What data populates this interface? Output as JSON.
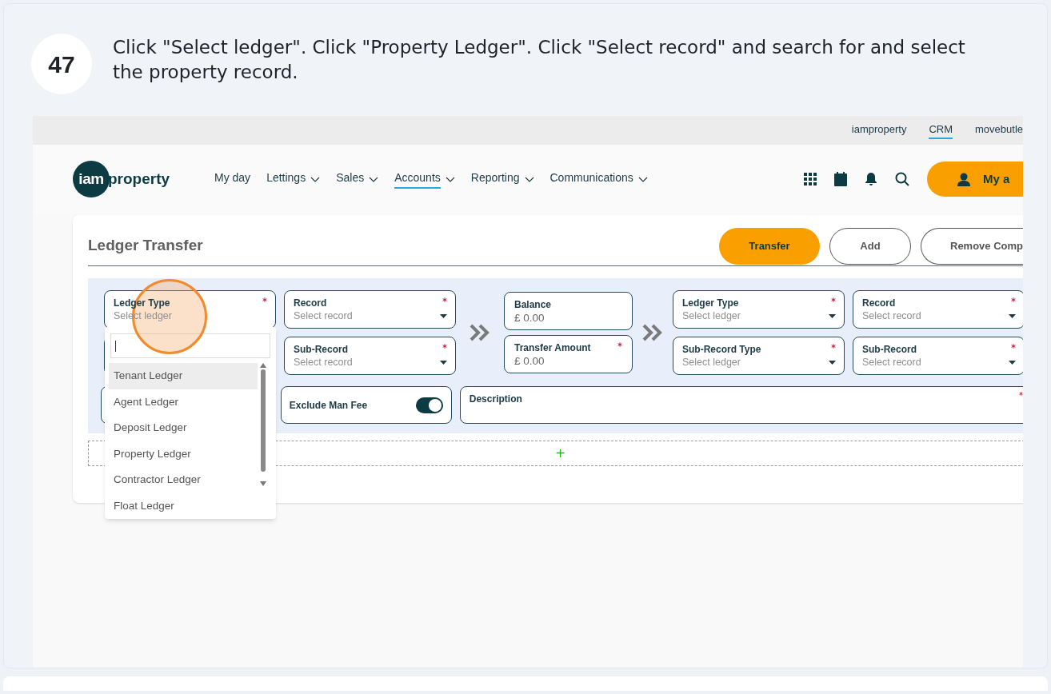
{
  "step": {
    "number": "47",
    "text": "Click \"Select ledger\". Click \"Property Ledger\". Click \"Select record\" and search for and select the property record."
  },
  "top_links": [
    {
      "label": "iamproperty",
      "selected": false
    },
    {
      "label": "CRM",
      "selected": true
    },
    {
      "label": "movebutle",
      "selected": false
    }
  ],
  "logo": {
    "mark": "iam",
    "word": "property"
  },
  "nav": [
    {
      "label": "My day",
      "dropdown": false,
      "selected": false
    },
    {
      "label": "Lettings",
      "dropdown": true,
      "selected": false
    },
    {
      "label": "Sales",
      "dropdown": true,
      "selected": false
    },
    {
      "label": "Accounts",
      "dropdown": true,
      "selected": true
    },
    {
      "label": "Reporting",
      "dropdown": true,
      "selected": false
    },
    {
      "label": "Communications",
      "dropdown": true,
      "selected": false
    }
  ],
  "account_button": "My a",
  "page_title": "Ledger Transfer",
  "actions": [
    {
      "label": "Transfer",
      "kind": "primary"
    },
    {
      "label": "Add",
      "kind": "outline"
    },
    {
      "label": "Remove Comp",
      "kind": "outline"
    }
  ],
  "from_fields": [
    {
      "label": "Ledger Type",
      "placeholder": "Select ledger",
      "required": true,
      "dropdown": false
    },
    {
      "label": "Record",
      "placeholder": "Select record",
      "required": true,
      "dropdown": true
    },
    {
      "label": "Sub-Record",
      "placeholder": "Select record",
      "required": true,
      "dropdown": true
    }
  ],
  "amount_fields": [
    {
      "label": "Balance",
      "value": "£ 0.00",
      "required": false
    },
    {
      "label": "Transfer Amount",
      "value": "£ 0.00",
      "required": true
    }
  ],
  "to_fields": [
    {
      "label": "Ledger Type",
      "placeholder": "Select ledger",
      "required": true,
      "dropdown": true
    },
    {
      "label": "Record",
      "placeholder": "Select record",
      "required": true,
      "dropdown": true
    },
    {
      "label": "Sub-Record Type",
      "placeholder": "Select ledger",
      "required": true,
      "dropdown": true
    },
    {
      "label": "Sub-Record",
      "placeholder": "Select record",
      "required": true,
      "dropdown": true
    }
  ],
  "toggle": {
    "label": "Exclude Man Fee",
    "on": true
  },
  "description": {
    "label": "Description",
    "required": true
  },
  "add_row": "+",
  "ledger_menu": {
    "items": [
      {
        "label": "Tenant Ledger",
        "selected": true
      },
      {
        "label": "Agent Ledger",
        "selected": false
      },
      {
        "label": "Deposit Ledger",
        "selected": false
      },
      {
        "label": "Property Ledger",
        "selected": false
      },
      {
        "label": "Contractor Ledger",
        "selected": false
      },
      {
        "label": "Float Ledger",
        "selected": false
      }
    ]
  }
}
